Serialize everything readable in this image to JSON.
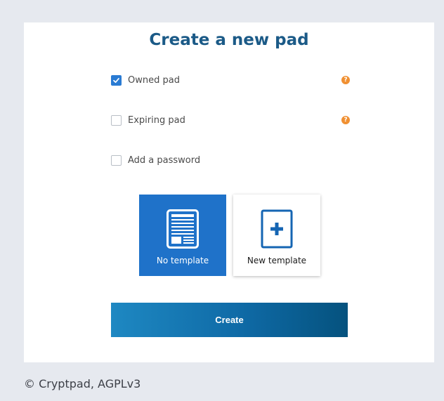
{
  "dialog": {
    "title": "Create a new pad",
    "options": [
      {
        "label": "Owned pad",
        "checked": true,
        "help_icon": "question-circle-icon"
      },
      {
        "label": "Expiring pad",
        "checked": false,
        "help_icon": "question-circle-icon"
      },
      {
        "label": "Add a password",
        "checked": false
      }
    ],
    "templates": [
      {
        "label": "No template",
        "icon": "document-icon",
        "selected": true
      },
      {
        "label": "New template",
        "icon": "add-square-icon",
        "selected": false
      }
    ],
    "create_label": "Create"
  },
  "footer": {
    "text": "© Cryptpad, AGPLv3"
  },
  "colors": {
    "title": "#1b5a87",
    "accent": "#2a7bd3",
    "help": "#f09032",
    "selected_template": "#1f72c9",
    "button_gradient_start": "#1e88c2",
    "button_gradient_end": "#05527e"
  }
}
